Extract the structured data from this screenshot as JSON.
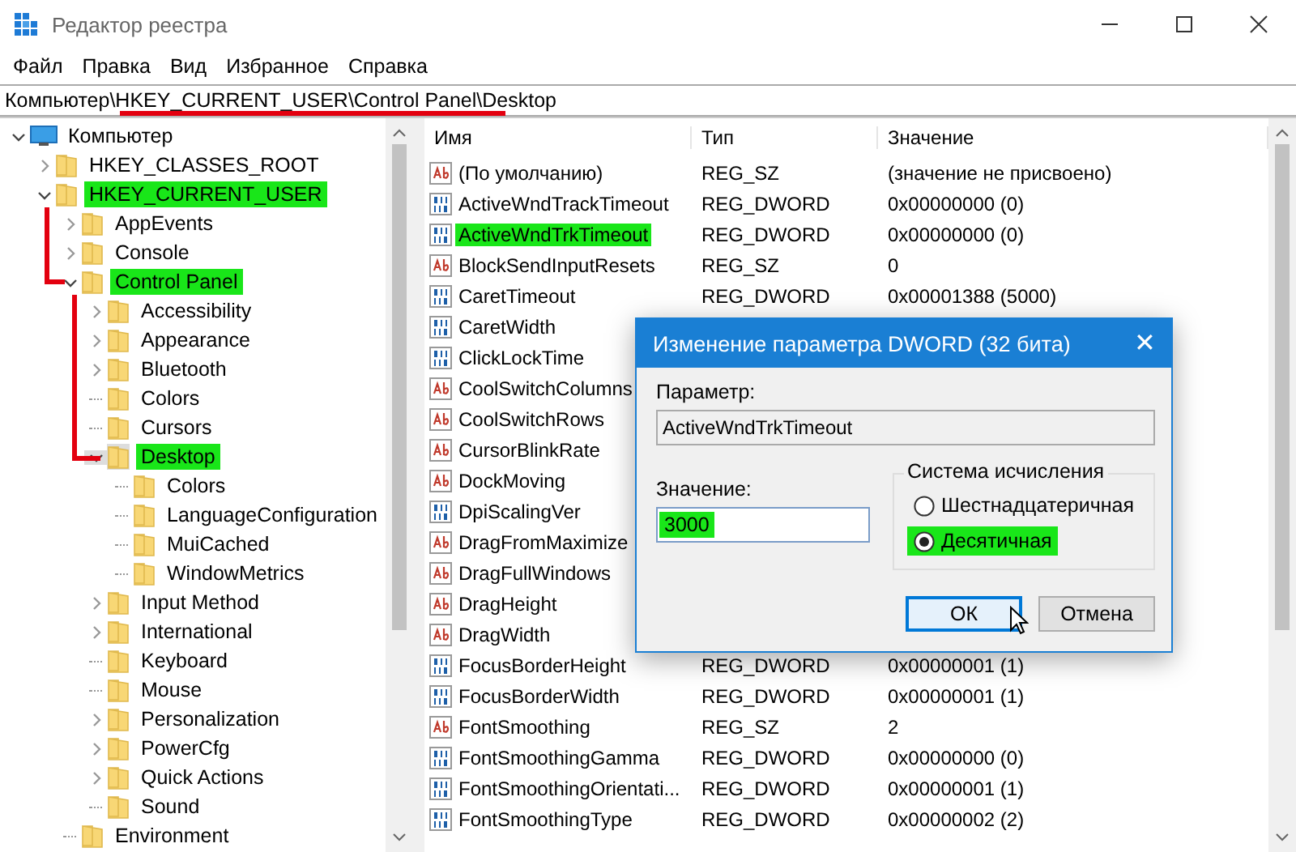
{
  "window": {
    "title": "Редактор реестра"
  },
  "menu": [
    "Файл",
    "Правка",
    "Вид",
    "Избранное",
    "Справка"
  ],
  "address": "Компьютер\\HKEY_CURRENT_USER\\Control Panel\\Desktop",
  "tree": [
    {
      "label": "Компьютер",
      "kind": "computer",
      "expanded": true,
      "selected": false,
      "highlighted": false,
      "children": [
        {
          "label": "HKEY_CLASSES_ROOT",
          "expanded": false,
          "selected": false,
          "highlighted": false
        },
        {
          "label": "HKEY_CURRENT_USER",
          "expanded": true,
          "selected": false,
          "highlighted": true,
          "children": [
            {
              "label": "AppEvents",
              "expanded": false,
              "selected": false,
              "highlighted": false
            },
            {
              "label": "Console",
              "expanded": false,
              "selected": false,
              "highlighted": false
            },
            {
              "label": "Control Panel",
              "expanded": true,
              "selected": false,
              "highlighted": true,
              "children": [
                {
                  "label": "Accessibility",
                  "expanded": false,
                  "selected": false,
                  "highlighted": false
                },
                {
                  "label": "Appearance",
                  "expanded": false,
                  "selected": false,
                  "highlighted": false
                },
                {
                  "label": "Bluetooth",
                  "expanded": false,
                  "selected": false,
                  "highlighted": false
                },
                {
                  "label": "Colors",
                  "selected": false,
                  "highlighted": false
                },
                {
                  "label": "Cursors",
                  "selected": false,
                  "highlighted": false
                },
                {
                  "label": "Desktop",
                  "expanded": true,
                  "selected": true,
                  "highlighted": true,
                  "children": [
                    {
                      "label": "Colors",
                      "selected": false,
                      "highlighted": false
                    },
                    {
                      "label": "LanguageConfiguration",
                      "selected": false,
                      "highlighted": false
                    },
                    {
                      "label": "MuiCached",
                      "selected": false,
                      "highlighted": false
                    },
                    {
                      "label": "WindowMetrics",
                      "selected": false,
                      "highlighted": false
                    }
                  ]
                },
                {
                  "label": "Input Method",
                  "expanded": false,
                  "selected": false,
                  "highlighted": false
                },
                {
                  "label": "International",
                  "expanded": false,
                  "selected": false,
                  "highlighted": false
                },
                {
                  "label": "Keyboard",
                  "selected": false,
                  "highlighted": false
                },
                {
                  "label": "Mouse",
                  "selected": false,
                  "highlighted": false
                },
                {
                  "label": "Personalization",
                  "expanded": false,
                  "selected": false,
                  "highlighted": false
                },
                {
                  "label": "PowerCfg",
                  "expanded": false,
                  "selected": false,
                  "highlighted": false
                },
                {
                  "label": "Quick Actions",
                  "expanded": false,
                  "selected": false,
                  "highlighted": false
                },
                {
                  "label": "Sound",
                  "selected": false,
                  "highlighted": false
                }
              ]
            },
            {
              "label": "Environment",
              "selected": false,
              "highlighted": false
            }
          ]
        }
      ]
    }
  ],
  "columns": [
    "Имя",
    "Тип",
    "Значение"
  ],
  "values": [
    {
      "kind": "sz",
      "name": "(По умолчанию)",
      "type": "REG_SZ",
      "value": "(значение не присвоено)",
      "highlighted": false
    },
    {
      "kind": "dword",
      "name": "ActiveWndTrackTimeout",
      "type": "REG_DWORD",
      "value": "0x00000000 (0)",
      "highlighted": false
    },
    {
      "kind": "dword",
      "name": "ActiveWndTrkTimeout",
      "type": "REG_DWORD",
      "value": "0x00000000 (0)",
      "highlighted": true
    },
    {
      "kind": "sz",
      "name": "BlockSendInputResets",
      "type": "REG_SZ",
      "value": "0",
      "highlighted": false
    },
    {
      "kind": "dword",
      "name": "CaretTimeout",
      "type": "REG_DWORD",
      "value": "0x00001388 (5000)",
      "highlighted": false
    },
    {
      "kind": "dword",
      "name": "CaretWidth",
      "highlighted": false
    },
    {
      "kind": "dword",
      "name": "ClickLockTime",
      "highlighted": false
    },
    {
      "kind": "sz",
      "name": "CoolSwitchColumns",
      "highlighted": false
    },
    {
      "kind": "sz",
      "name": "CoolSwitchRows",
      "highlighted": false
    },
    {
      "kind": "sz",
      "name": "CursorBlinkRate",
      "highlighted": false
    },
    {
      "kind": "sz",
      "name": "DockMoving",
      "highlighted": false
    },
    {
      "kind": "dword",
      "name": "DpiScalingVer",
      "highlighted": false
    },
    {
      "kind": "sz",
      "name": "DragFromMaximize",
      "highlighted": false
    },
    {
      "kind": "sz",
      "name": "DragFullWindows",
      "highlighted": false
    },
    {
      "kind": "sz",
      "name": "DragHeight",
      "highlighted": false
    },
    {
      "kind": "sz",
      "name": "DragWidth",
      "highlighted": false
    },
    {
      "kind": "dword",
      "name": "FocusBorderHeight",
      "type": "REG_DWORD",
      "value": "0x00000001 (1)",
      "highlighted": false
    },
    {
      "kind": "dword",
      "name": "FocusBorderWidth",
      "type": "REG_DWORD",
      "value": "0x00000001 (1)",
      "highlighted": false
    },
    {
      "kind": "sz",
      "name": "FontSmoothing",
      "type": "REG_SZ",
      "value": "2",
      "highlighted": false
    },
    {
      "kind": "dword",
      "name": "FontSmoothingGamma",
      "type": "REG_DWORD",
      "value": "0x00000000 (0)",
      "highlighted": false
    },
    {
      "kind": "dword",
      "name": "FontSmoothingOrientati...",
      "type": "REG_DWORD",
      "value": "0x00000001 (1)",
      "highlighted": false
    },
    {
      "kind": "dword",
      "name": "FontSmoothingType",
      "type": "REG_DWORD",
      "value": "0x00000002 (2)",
      "highlighted": false
    }
  ],
  "dialog": {
    "title": "Изменение параметра DWORD (32 бита)",
    "close": "✕",
    "parameter_label": "Параметр:",
    "parameter_value": "ActiveWndTrkTimeout",
    "value_label": "Значение:",
    "value": "3000",
    "value_highlighted": true,
    "radix": {
      "title": "Система исчисления",
      "options": [
        {
          "label": "Шестнадцатеричная",
          "selected": false,
          "highlighted": false
        },
        {
          "label": "Десятичная",
          "selected": true,
          "highlighted": true
        }
      ]
    },
    "buttons": [
      {
        "label": "ОК",
        "default": true
      },
      {
        "label": "Отмена",
        "default": false
      }
    ]
  }
}
